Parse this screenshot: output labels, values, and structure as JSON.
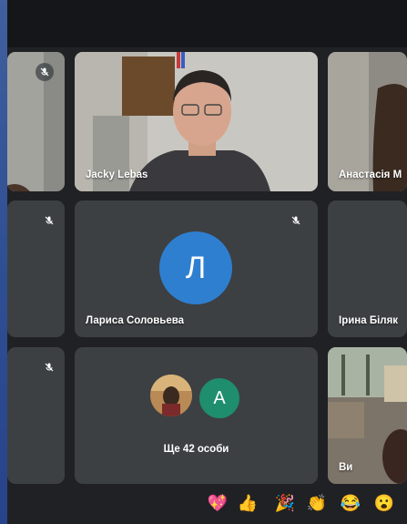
{
  "tiles": {
    "t1": {
      "name": ""
    },
    "t2": {
      "name": "Jacky Lebas"
    },
    "t3": {
      "name": "Анастасія М"
    },
    "t4": {
      "name": ""
    },
    "t5": {
      "name": "Лариса Соловьева",
      "initial": "Л",
      "avatar_color": "#2f7fd0"
    },
    "t6": {
      "name": "Ірина Біляк"
    },
    "t7": {
      "name": ""
    },
    "t8": {
      "label": "Ще 42 особи",
      "initial": "A",
      "avatar_color": "#1e8e6e"
    },
    "t9": {
      "name": "Ви"
    }
  },
  "reactions": [
    {
      "icon": "sparkling-heart-icon",
      "glyph": "💖"
    },
    {
      "icon": "thumbs-up-icon",
      "glyph": "👍"
    },
    {
      "icon": "party-popper-icon",
      "glyph": "🎉"
    },
    {
      "icon": "clapping-hands-icon",
      "glyph": "👏"
    },
    {
      "icon": "laughing-face-icon",
      "glyph": "😂"
    },
    {
      "icon": "surprised-face-icon",
      "glyph": "😮"
    }
  ],
  "colors": {
    "background": "#202124",
    "tile": "#3c4043",
    "accent_blue": "#2f7fd0",
    "accent_green": "#1e8e6e"
  }
}
